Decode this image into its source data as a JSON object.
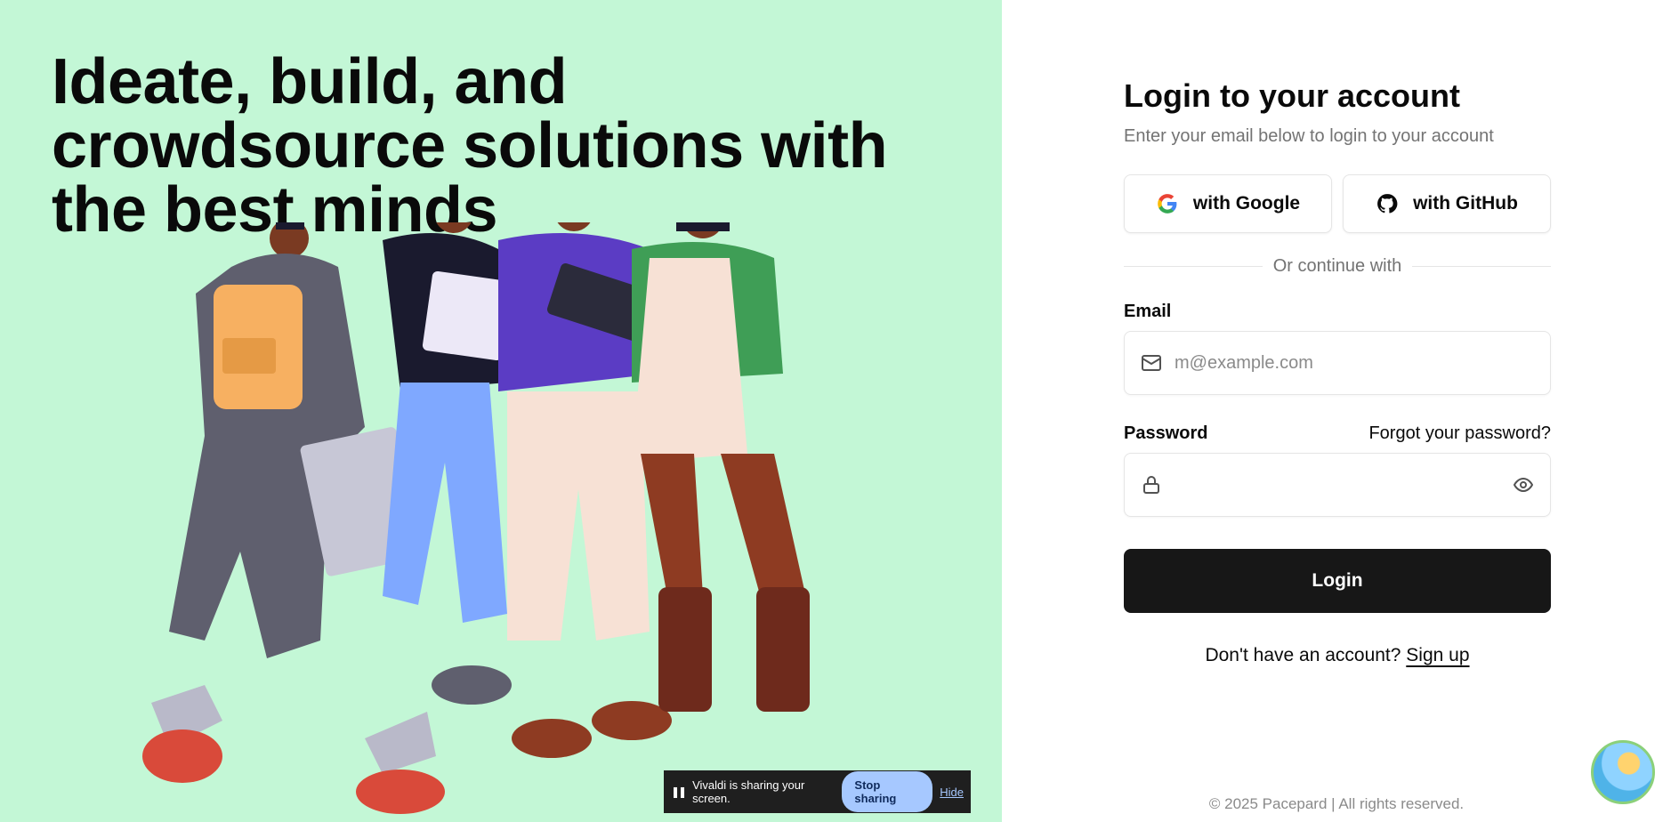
{
  "hero": {
    "headline": "Ideate, build, and crowdsource solutions with the best minds"
  },
  "login": {
    "title": "Login to your account",
    "subtitle": "Enter your email below to login to your account",
    "google_label": "with Google",
    "github_label": "with GitHub",
    "divider_text": "Or continue with",
    "email_label": "Email",
    "email_placeholder": "m@example.com",
    "email_value": "",
    "password_label": "Password",
    "password_value": "",
    "forgot_label": "Forgot your password?",
    "login_button": "Login",
    "signup_prompt": "Don't have an account?",
    "signup_link": "Sign up"
  },
  "footer": {
    "copyright": "© 2025 Pacepard | All rights reserved."
  },
  "screen_share": {
    "status": "Vivaldi is sharing your screen.",
    "stop_label": "Stop sharing",
    "hide_label": "Hide"
  },
  "icons": {
    "google": "google-logo-icon",
    "github": "github-logo-icon",
    "mail": "mail-icon",
    "lock": "lock-icon",
    "eye": "eye-icon"
  },
  "colors": {
    "hero_bg": "#c3f7d6",
    "primary_button": "#171717",
    "muted_text": "#737373"
  }
}
